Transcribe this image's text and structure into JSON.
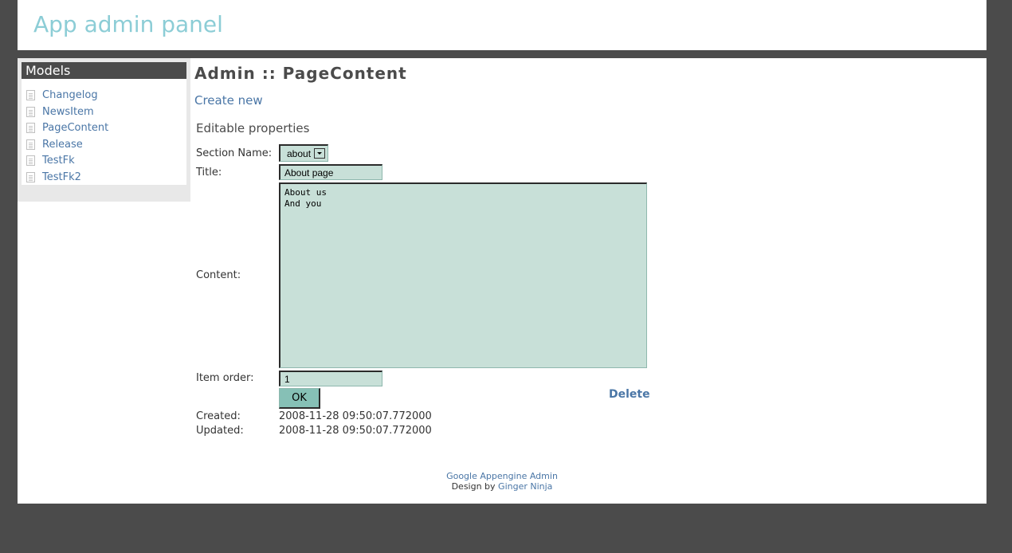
{
  "header": {
    "title": "App admin panel"
  },
  "sidebar": {
    "heading": "Models",
    "items": [
      {
        "label": "Changelog",
        "icon": "document-icon"
      },
      {
        "label": "NewsItem",
        "icon": "document-icon"
      },
      {
        "label": "PageContent",
        "icon": "document-icon"
      },
      {
        "label": "Release",
        "icon": "document-icon"
      },
      {
        "label": "TestFk",
        "icon": "document-icon"
      },
      {
        "label": "TestFk2",
        "icon": "document-icon"
      }
    ]
  },
  "main": {
    "page_title": "Admin :: PageContent",
    "create_new": "Create new",
    "editable_heading": "Editable properties",
    "form": {
      "section_name_label": "Section Name:",
      "section_name_value": "about",
      "title_label": "Title:",
      "title_value": "About page",
      "content_label": "Content:",
      "content_value": "About us\nAnd you",
      "item_order_label": "Item order:",
      "item_order_value": "1",
      "ok_label": "OK",
      "delete_label": "Delete",
      "created_label": "Created:",
      "created_value": "2008-11-28 09:50:07.772000",
      "updated_label": "Updated:",
      "updated_value": "2008-11-28 09:50:07.772000"
    }
  },
  "footer": {
    "line1_link": "Google Appengine Admin",
    "line2_prefix": "Design by",
    "line2_link": "Ginger Ninja"
  },
  "colors": {
    "page_bg": "#4b4b4b",
    "title_accent": "#8ccdd6",
    "link": "#4a76a6",
    "field_bg": "#c8e0d8",
    "button_bg": "#86c0b6"
  }
}
